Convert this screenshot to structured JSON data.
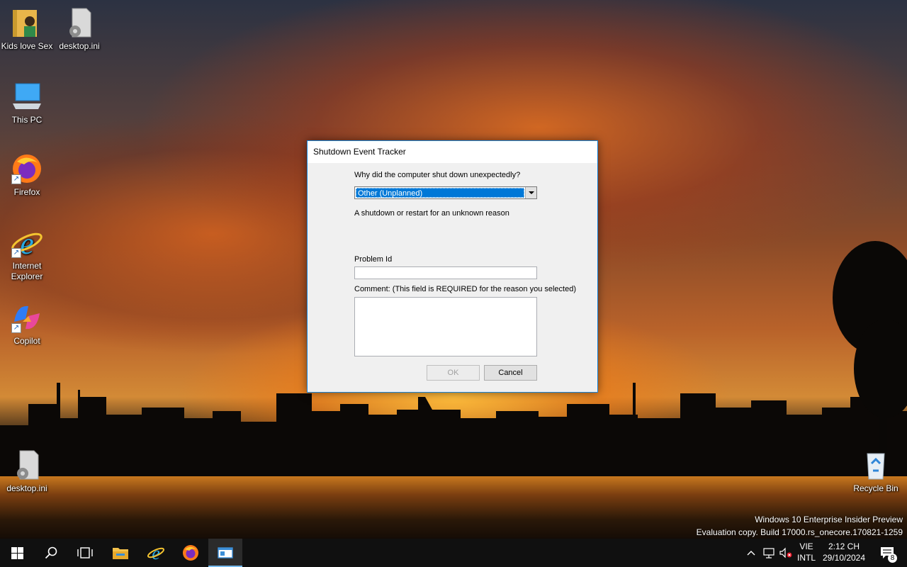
{
  "desktop": {
    "icons_left": [
      {
        "label": "Kids love Sex",
        "icon": "folder-user-icon"
      },
      {
        "label": "desktop.ini",
        "icon": "settings-file-icon"
      },
      {
        "label": "This PC",
        "icon": "computer-icon"
      },
      {
        "label": "Firefox",
        "icon": "firefox-icon"
      },
      {
        "label": "Internet Explorer",
        "icon": "internet-explorer-icon"
      },
      {
        "label": "Copilot",
        "icon": "copilot-icon"
      },
      {
        "label": "desktop.ini",
        "icon": "settings-file-icon"
      }
    ],
    "recycle_bin": {
      "label": "Recycle Bin",
      "icon": "recycle-bin-icon"
    },
    "watermark": {
      "line1": "Windows 10 Enterprise Insider Preview",
      "line2": "Evaluation copy. Build 17000.rs_onecore.170821-1259"
    }
  },
  "dialog": {
    "title": "Shutdown Event Tracker",
    "question": "Why did the computer shut down unexpectedly?",
    "reason_selected": "Other (Unplanned)",
    "reason_description": "A shutdown or restart for an unknown reason",
    "problem_id_label": "Problem Id",
    "problem_id_value": "",
    "comment_label": "Comment: (This field is REQUIRED for the reason you selected)",
    "comment_value": "",
    "ok_label": "OK",
    "cancel_label": "Cancel",
    "accent_color": "#0078d7"
  },
  "taskbar": {
    "apps": [
      {
        "name": "start",
        "icon": "windows-start-icon"
      },
      {
        "name": "search",
        "icon": "search-icon"
      },
      {
        "name": "task-view",
        "icon": "task-view-icon"
      },
      {
        "name": "file-explorer",
        "icon": "folder-icon"
      },
      {
        "name": "internet-explorer",
        "icon": "internet-explorer-icon"
      },
      {
        "name": "firefox",
        "icon": "firefox-icon"
      },
      {
        "name": "active-window",
        "icon": "window-icon"
      }
    ],
    "language_line1": "VIE",
    "language_line2": "INTL",
    "time": "2:12 CH",
    "date": "29/10/2024",
    "notification_count": "8"
  }
}
